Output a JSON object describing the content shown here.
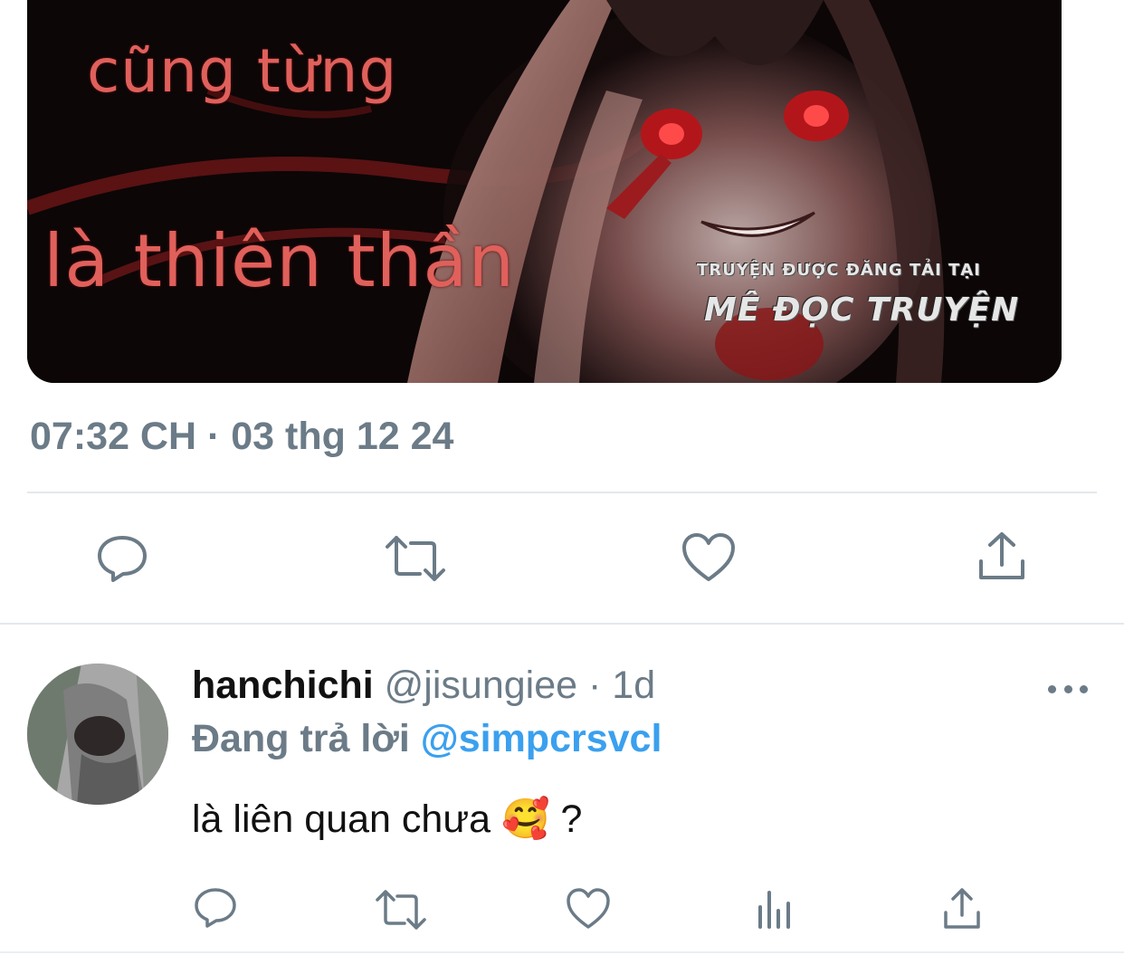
{
  "tweet": {
    "media": {
      "caption_line1": "cũng từng",
      "caption_line2": "là thiên thần",
      "watermark_top": "TRUYỆN ĐƯỢC ĐĂNG TẢI TẠI",
      "watermark_bottom": "MÊ ĐỌC TRUYỆN"
    },
    "timestamp": "07:32 CH · 03 thg 12 24",
    "actions": [
      {
        "icon": "reply-icon"
      },
      {
        "icon": "retweet-icon"
      },
      {
        "icon": "like-icon"
      },
      {
        "icon": "share-icon"
      }
    ]
  },
  "reply": {
    "display_name": "hanchichi",
    "handle": "@jisungiee",
    "separator": "·",
    "age": "1d",
    "replying_to_label": "Đang trả lời",
    "replying_to_handle": "@simpcrsvcl",
    "text": "là liên quan chưa 🥰 ?",
    "more_icon": "more-icon",
    "actions": [
      {
        "icon": "reply-icon"
      },
      {
        "icon": "retweet-icon"
      },
      {
        "icon": "like-icon"
      },
      {
        "icon": "analytics-icon"
      },
      {
        "icon": "share-icon"
      }
    ]
  },
  "colors": {
    "secondary_text": "#6b7b87",
    "link": "#3aa0ef",
    "divider": "#e4e8eb",
    "primary_text": "#111111"
  }
}
